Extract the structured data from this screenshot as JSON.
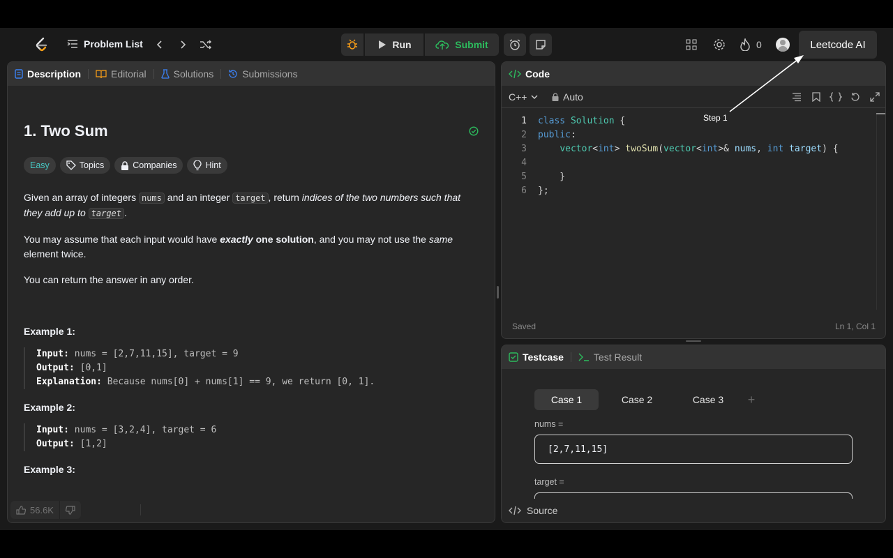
{
  "topbar": {
    "problem_list_label": "Problem List",
    "run_label": "Run",
    "submit_label": "Submit",
    "streak_count": "0",
    "ai_button_label": "Leetcode AI"
  },
  "annotation": {
    "step_label": "Step 1"
  },
  "description_panel": {
    "tabs": [
      "Description",
      "Editorial",
      "Solutions",
      "Submissions"
    ],
    "title": "1. Two Sum",
    "chips": [
      "Easy",
      "Topics",
      "Companies",
      "Hint"
    ],
    "p1": {
      "t1": "Given an array of integers ",
      "c1": "nums",
      "t2": " and an integer ",
      "c2": "target",
      "t3": ", return ",
      "i1": "indices of the two numbers such that they add up to",
      "t4": " ",
      "c3": "target",
      "t5": "."
    },
    "p2": {
      "t1": "You may assume that each input would have ",
      "b1": "exactly",
      "b2": " one solution",
      "t2": ", and you may not use the ",
      "i1": "same",
      "t3": " element twice."
    },
    "p3": "You can return the answer in any order.",
    "examples": [
      {
        "title": "Example 1:",
        "input": "nums = [2,7,11,15], target = 9",
        "output": "[0,1]",
        "explanation": "Because nums[0] + nums[1] == 9, we return [0, 1]."
      },
      {
        "title": "Example 2:",
        "input": "nums = [3,2,4], target = 6",
        "output": "[1,2]"
      },
      {
        "title": "Example 3:"
      }
    ],
    "labels": {
      "input": "Input:",
      "output": "Output:",
      "explanation": "Explanation:"
    },
    "likes": "56.6K"
  },
  "code_panel": {
    "header": "Code",
    "language": "C++",
    "mode": "Auto",
    "status": "Saved",
    "cursor": "Ln 1, Col 1",
    "line_numbers": [
      "1",
      "2",
      "3",
      "4",
      "5",
      "6"
    ]
  },
  "testcase_panel": {
    "tabs": [
      "Testcase",
      "Test Result"
    ],
    "cases": [
      "Case 1",
      "Case 2",
      "Case 3"
    ],
    "add_label": "+",
    "fields": [
      {
        "label": "nums =",
        "value": "[2,7,11,15]"
      },
      {
        "label": "target =",
        "value": ""
      }
    ],
    "source_label": "Source"
  },
  "colors": {
    "accent_green": "#2cbb5d",
    "easy": "#46c6c2",
    "panel_bg": "#262626",
    "header_bg": "#333333"
  }
}
